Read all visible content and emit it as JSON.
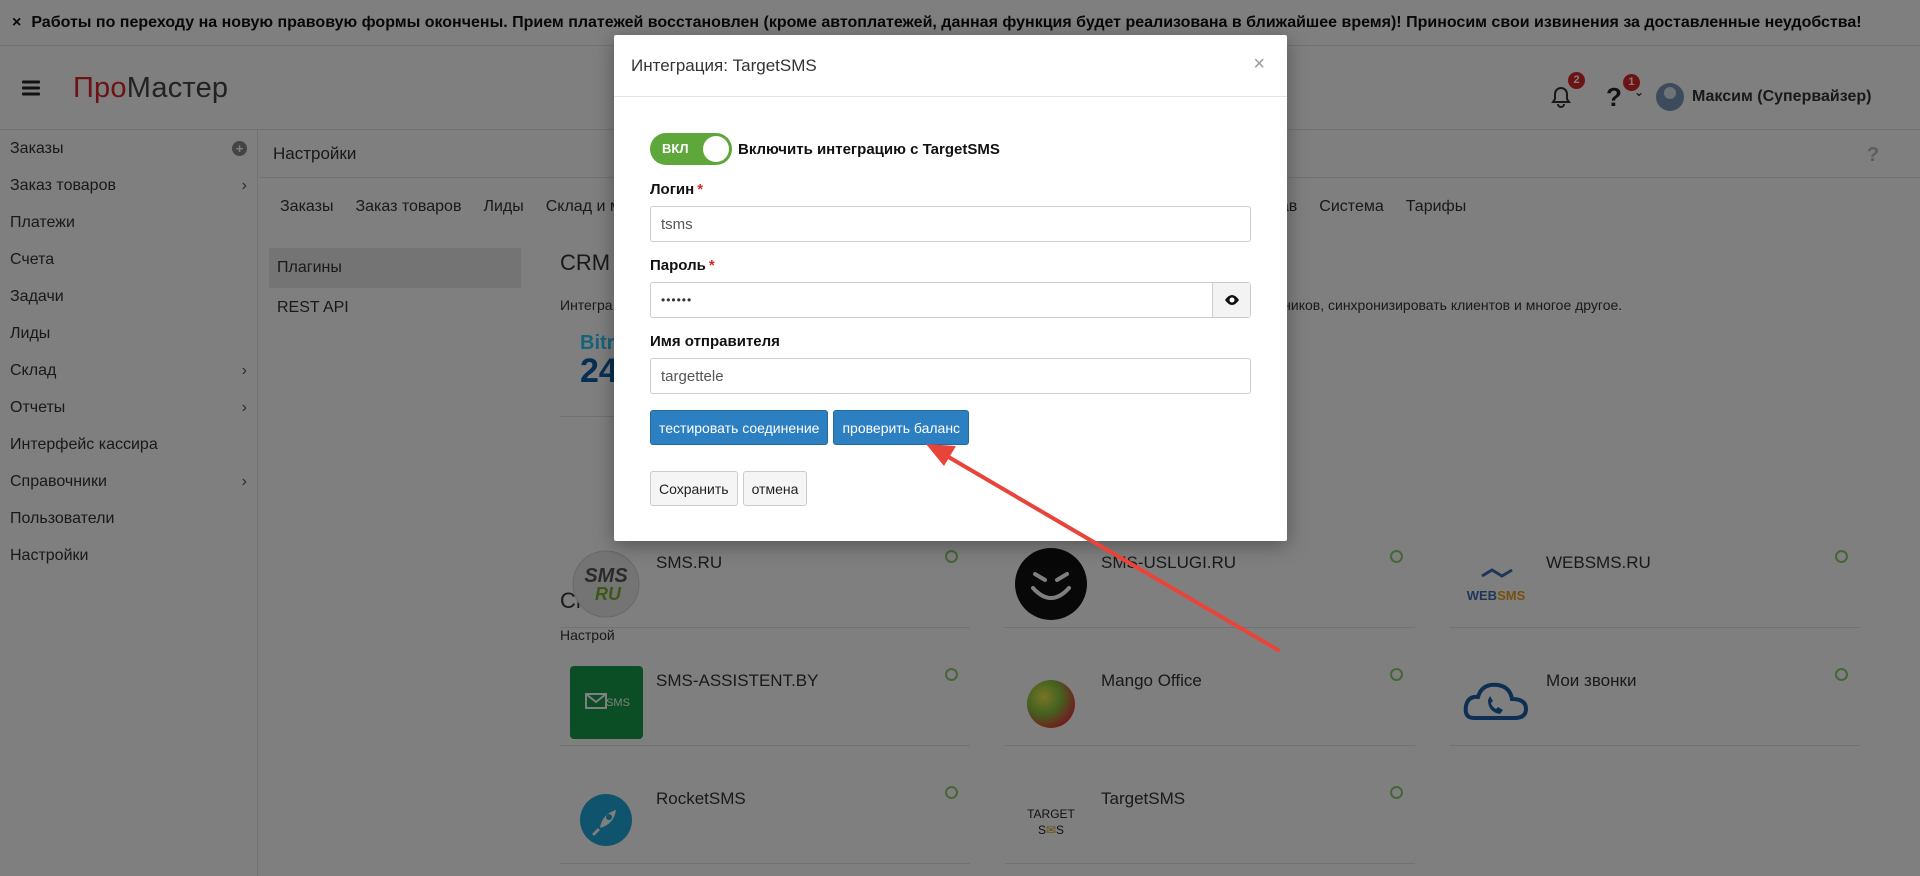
{
  "announcement": {
    "close_glyph": "×",
    "text": "Работы по переходу на новую правовую формы окончены. Прием платежей восстановлен (кроме автоплатежей, данная функция будет реализована в ближайшее время)! Приносим свои извинения за доставленные неудобства!"
  },
  "header": {
    "logo_part1": "Про",
    "logo_part2": "Мастер",
    "notifications_count": "2",
    "help_count": "1",
    "user_name": "Максим (Супервайзер)"
  },
  "sidebar": {
    "items": [
      {
        "label": "Заказы",
        "suffix": "plus"
      },
      {
        "label": "Заказ товаров",
        "suffix": "arrow"
      },
      {
        "label": "Платежи",
        "suffix": ""
      },
      {
        "label": "Счета",
        "suffix": ""
      },
      {
        "label": "Задачи",
        "suffix": ""
      },
      {
        "label": "Лиды",
        "suffix": ""
      },
      {
        "label": "Склад",
        "suffix": "arrow"
      },
      {
        "label": "Отчеты",
        "suffix": "arrow"
      },
      {
        "label": "Интерфейс кассира",
        "suffix": ""
      },
      {
        "label": "Справочники",
        "suffix": "arrow"
      },
      {
        "label": "Пользователи",
        "suffix": ""
      },
      {
        "label": "Настройки",
        "suffix": ""
      }
    ]
  },
  "page": {
    "title": "Настройки",
    "tabs_left": [
      "Заказы",
      "Заказ товаров",
      "Лиды",
      "Склад и м"
    ],
    "tabs_right": [
      "рав",
      "Система",
      "Тарифы"
    ],
    "subnav": [
      "Плагины",
      "REST API"
    ],
    "crm_title": "CRM",
    "crm_desc_left": "Интегра",
    "crm_desc_right": "дников, синхронизировать клиентов и многое другое.",
    "bitrix_text_1": "Bitr",
    "bitrix_text_2": "24",
    "sms_title": "СМС",
    "sms_desc": "Настрой"
  },
  "sms_cards": [
    {
      "name": "SMS.RU",
      "icon": "smsru-logo"
    },
    {
      "name": "SMS-USLUGI.RU",
      "icon": "smiley-logo"
    },
    {
      "name": "WEBSMS.RU",
      "icon": "websms-logo"
    },
    {
      "name": "SMS-ASSISTENT.BY",
      "icon": "sms-assistent-logo"
    },
    {
      "name": "Mango Office",
      "icon": "mango-logo"
    },
    {
      "name": "Мои звонки",
      "icon": "cloud-phone-logo"
    },
    {
      "name": "RocketSMS",
      "icon": "rocket-logo"
    },
    {
      "name": "TargetSMS",
      "icon": "targetsms-logo"
    }
  ],
  "modal": {
    "title": "Интеграция: TargetSMS",
    "close_glyph": "×",
    "toggle_label": "ВКЛ",
    "toggle_text": "Включить интеграцию с TargetSMS",
    "login_label": "Логин",
    "login_value": "tsms",
    "password_label": "Пароль",
    "password_value": "••••••",
    "sender_label": "Имя отправителя",
    "sender_value": "targettele",
    "test_button": "тестировать соединение",
    "balance_button": "проверить баланс",
    "save_button": "Сохранить",
    "cancel_button": "отмена",
    "required_mark": "*"
  },
  "colors": {
    "brand_red": "#d9262b",
    "button_blue": "#2c7fc0",
    "toggle_green": "#5ea83b",
    "status_dot": "#8fcb6d",
    "annotation_arrow": "#e8443a"
  }
}
